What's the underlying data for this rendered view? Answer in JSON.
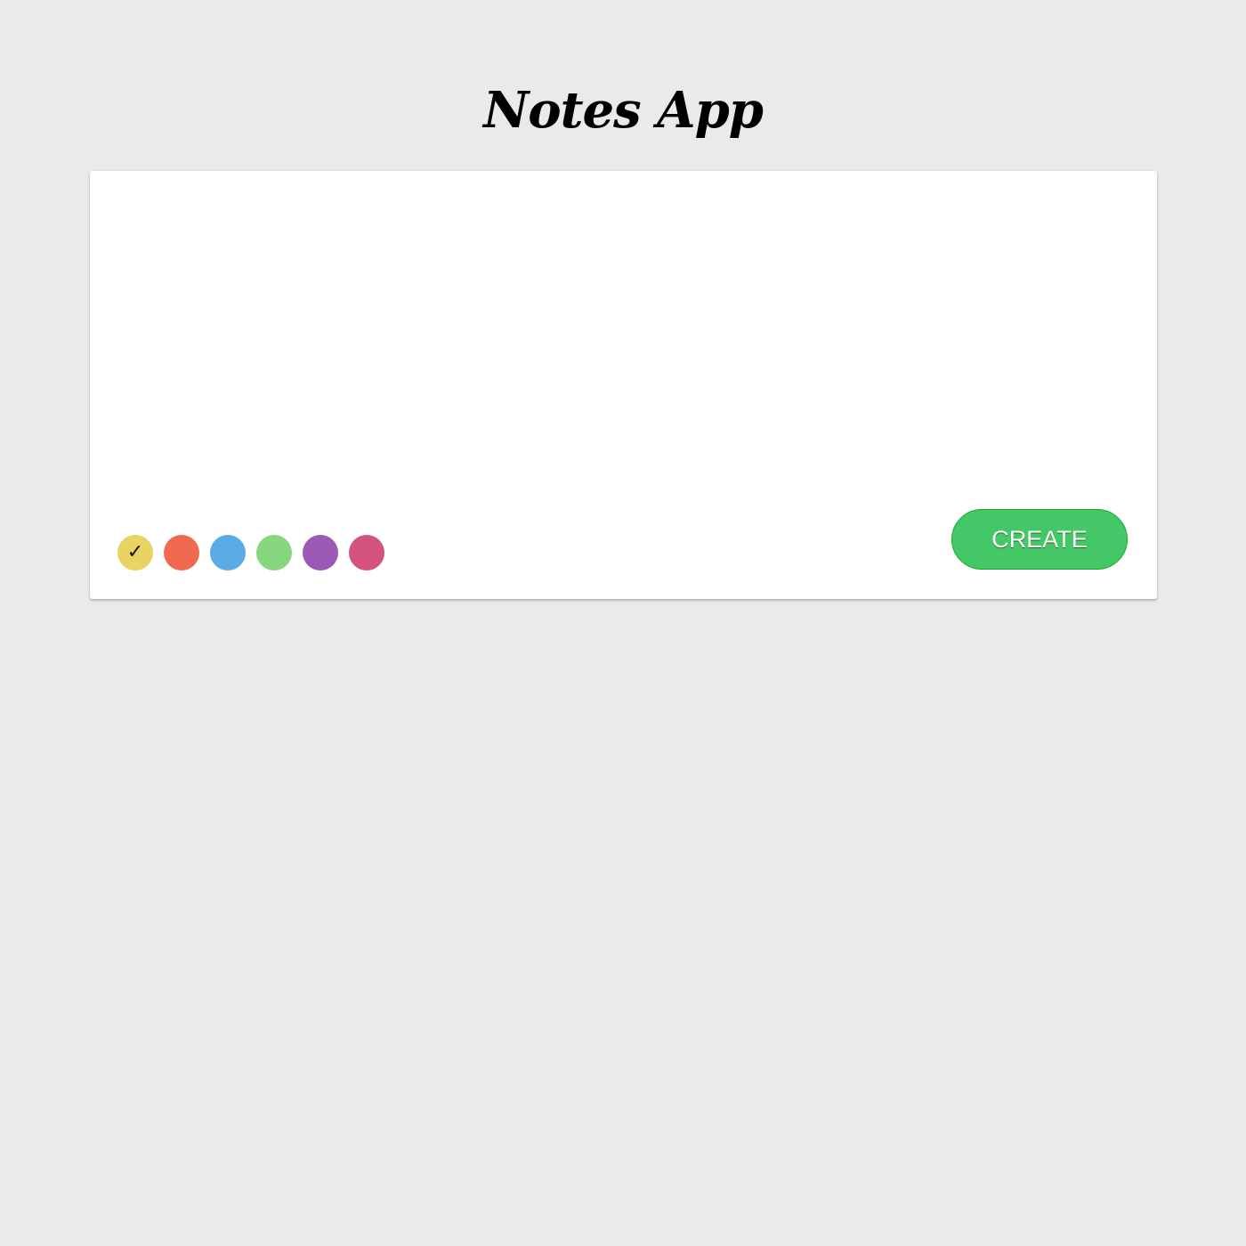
{
  "app": {
    "title": "Notes App"
  },
  "editor": {
    "note_text": "",
    "placeholder": ""
  },
  "color_picker": {
    "selected_index": 0,
    "selected_mark": "✓",
    "colors": [
      {
        "name": "yellow",
        "hex": "#e8d463"
      },
      {
        "name": "orange-red",
        "hex": "#ef6a4f"
      },
      {
        "name": "blue",
        "hex": "#5aace4"
      },
      {
        "name": "green",
        "hex": "#86d77d"
      },
      {
        "name": "purple",
        "hex": "#9b59b6"
      },
      {
        "name": "pink",
        "hex": "#d3527e"
      }
    ]
  },
  "actions": {
    "create_label": "CREATE"
  },
  "theme": {
    "page_background": "#eaeaea",
    "card_background": "#ffffff",
    "create_button": "#44c767",
    "create_button_border": "#18ab29"
  }
}
